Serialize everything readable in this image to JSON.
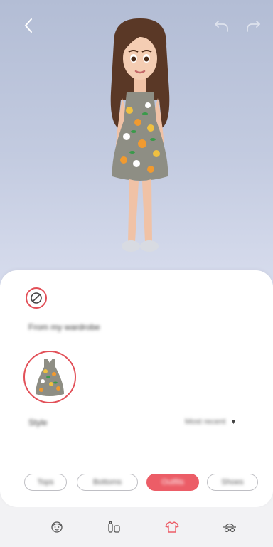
{
  "toolbar": {
    "back_icon": "chevron-left-icon",
    "undo_icon": "undo-icon",
    "redo_icon": "redo-icon"
  },
  "panel": {
    "none_option_icon": "prohibited-icon",
    "section_title": "From my wardrobe",
    "selected_item": "dress-thumbnail",
    "style_label": "Style",
    "sort_value": "Most recent",
    "sort_icon": "triangle-down-icon"
  },
  "categories": [
    {
      "label": "Tops",
      "active": false
    },
    {
      "label": "Bottoms",
      "active": false
    },
    {
      "label": "Outfits",
      "active": true
    },
    {
      "label": "Shoes",
      "active": false
    }
  ],
  "bottom_nav": [
    {
      "icon": "face-icon",
      "active": false
    },
    {
      "icon": "body-icon",
      "active": false
    },
    {
      "icon": "shirt-icon",
      "active": true
    },
    {
      "icon": "accessories-icon",
      "active": false
    }
  ],
  "colors": {
    "accent": "#ec5d67",
    "scene_top": "#b3bdd5",
    "scene_bottom": "#d7dced"
  }
}
